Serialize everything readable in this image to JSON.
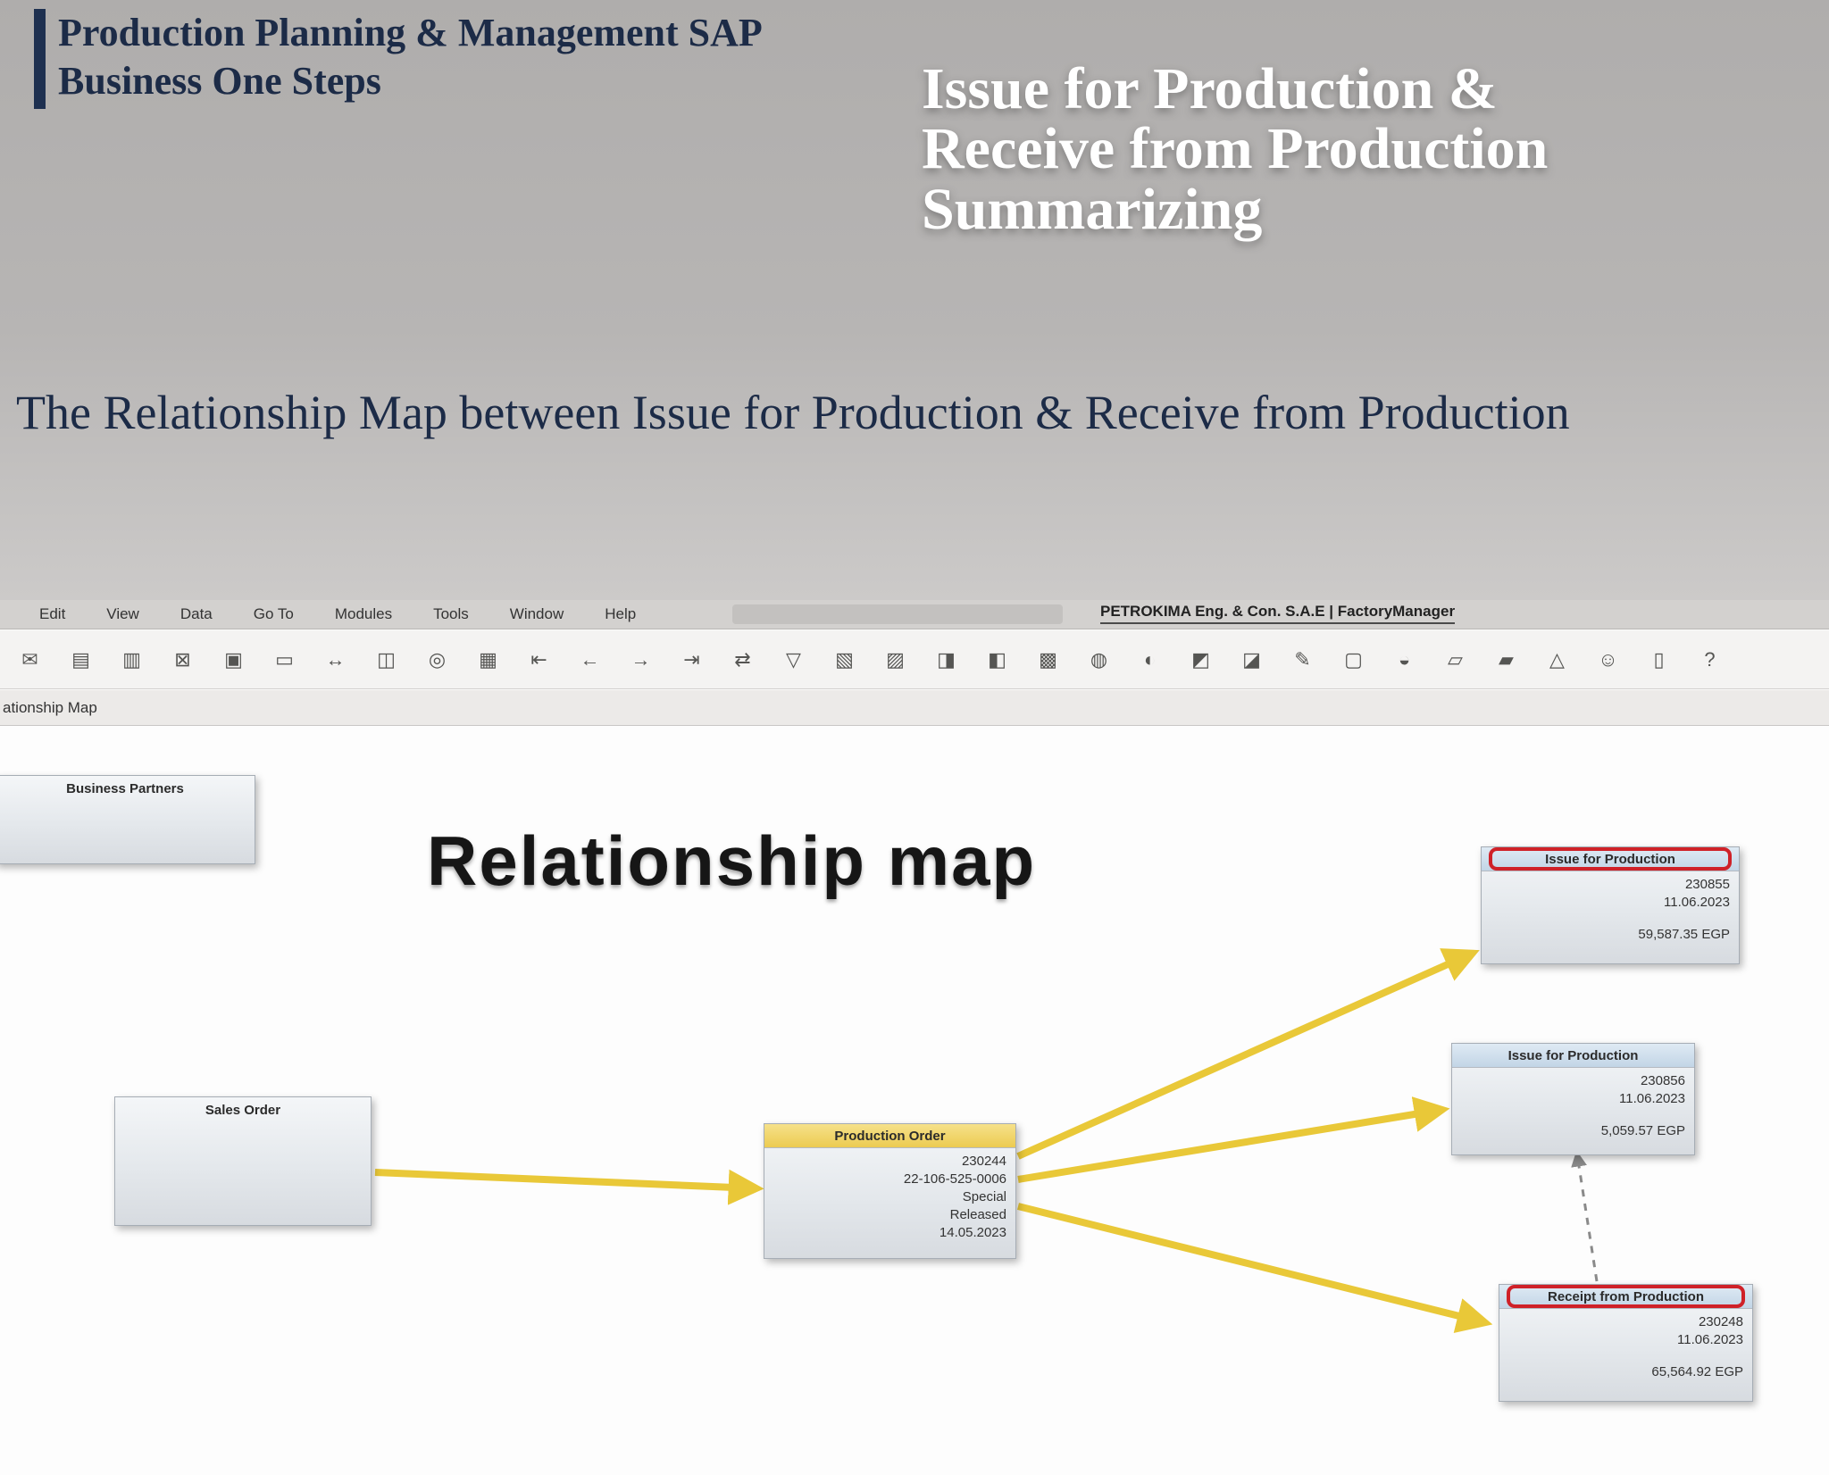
{
  "colors": {
    "accent_navy": "#1c2b47",
    "arrow_yellow": "#e9c838",
    "highlight_red": "#cf2128",
    "production_header_yellow": "#eccb51",
    "issue_header_blue": "#c2d5e6"
  },
  "slide": {
    "kicker_line1": "Production Planning  & Management SAP",
    "kicker_line2": "Business One Steps",
    "title_line1": "Issue for Production &",
    "title_line2": "Receive from Production",
    "title_line3": "Summarizing",
    "subtitle": "The Relationship Map between Issue for Production & Receive from Production"
  },
  "sap": {
    "menu": [
      "Edit",
      "View",
      "Data",
      "Go To",
      "Modules",
      "Tools",
      "Window",
      "Help"
    ],
    "account": "PETROKIMA Eng. & Con. S.A.E | FactoryManager",
    "tab": "ationship Map",
    "toolbar": [
      {
        "name": "mail-icon",
        "glyph": "✉"
      },
      {
        "name": "print-icon",
        "glyph": "▤"
      },
      {
        "name": "print-preview-icon",
        "glyph": "▥"
      },
      {
        "name": "export-excel-icon",
        "glyph": "⊠"
      },
      {
        "name": "export-word-icon",
        "glyph": "▣"
      },
      {
        "name": "export-pdf-icon",
        "glyph": "▭"
      },
      {
        "name": "move-icon",
        "glyph": "↔"
      },
      {
        "name": "layout-designer-icon",
        "glyph": "◫"
      },
      {
        "name": "find-icon",
        "glyph": "◎"
      },
      {
        "name": "form-settings-icon",
        "glyph": "▦"
      },
      {
        "name": "first-record-icon",
        "glyph": "⇤"
      },
      {
        "name": "previous-record-icon",
        "glyph": "←"
      },
      {
        "name": "next-record-icon",
        "glyph": "→"
      },
      {
        "name": "last-record-icon",
        "glyph": "⇥"
      },
      {
        "name": "refresh-icon",
        "glyph": "⇄"
      },
      {
        "name": "filter-icon",
        "glyph": "▽"
      },
      {
        "name": "picture-icon",
        "glyph": "▧"
      },
      {
        "name": "document-draft-icon",
        "glyph": "▨"
      },
      {
        "name": "add-mode-icon",
        "glyph": "◨"
      },
      {
        "name": "find-mode-icon",
        "glyph": "◧"
      },
      {
        "name": "journal-entry-icon",
        "glyph": "▩"
      },
      {
        "name": "payment-means-icon",
        "glyph": "◍"
      },
      {
        "name": "gross-profit-icon",
        "glyph": "◐"
      },
      {
        "name": "base-document-icon",
        "glyph": "◩"
      },
      {
        "name": "target-document-icon",
        "glyph": "◪"
      },
      {
        "name": "edit-icon",
        "glyph": "✎"
      },
      {
        "name": "document-settings-icon",
        "glyph": "▢"
      },
      {
        "name": "alerts-icon",
        "glyph": "◒"
      },
      {
        "name": "messages-icon",
        "glyph": "▱"
      },
      {
        "name": "calendar-icon",
        "glyph": "▰"
      },
      {
        "name": "organization-chart-icon",
        "glyph": "△"
      },
      {
        "name": "user-icon",
        "glyph": "☺"
      },
      {
        "name": "query-manager-icon",
        "glyph": "▯"
      },
      {
        "name": "help-icon",
        "glyph": "?"
      }
    ]
  },
  "map": {
    "title": "Relationship map",
    "business_partners": {
      "title": "Business Partners"
    },
    "sales_order": {
      "title": "Sales Order"
    },
    "production_order": {
      "title": "Production Order",
      "lines": [
        "230244",
        "22-106-525-0006",
        "Special",
        "Released",
        "14.05.2023"
      ]
    },
    "issue_top": {
      "title": "Issue for Production",
      "lines": [
        "230855",
        "11.06.2023",
        "59,587.35 EGP"
      ]
    },
    "issue_mid": {
      "title": "Issue for Production",
      "lines": [
        "230856",
        "11.06.2023",
        "5,059.57 EGP"
      ]
    },
    "receipt": {
      "title": "Receipt from Production",
      "lines": [
        "230248",
        "11.06.2023",
        "65,564.92 EGP"
      ]
    }
  }
}
